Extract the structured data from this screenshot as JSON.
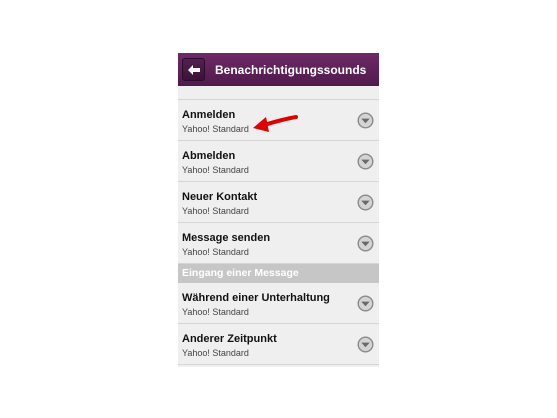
{
  "header": {
    "title": "Benachrichtigungssounds"
  },
  "items_top": [
    {
      "label": "Anmelden",
      "value": "Yahoo! Standard"
    },
    {
      "label": "Abmelden",
      "value": "Yahoo! Standard"
    },
    {
      "label": "Neuer Kontakt",
      "value": "Yahoo! Standard"
    },
    {
      "label": "Message senden",
      "value": "Yahoo! Standard"
    }
  ],
  "section": {
    "title": "Eingang einer Message"
  },
  "items_bottom": [
    {
      "label": "Während einer Unterhaltung",
      "value": "Yahoo! Standard"
    },
    {
      "label": "Anderer Zeitpunkt",
      "value": "Yahoo! Standard"
    }
  ],
  "colors": {
    "header": "#5e2058",
    "annotation_arrow": "#e00000",
    "section_bg": "#c6c6c6"
  },
  "icons": {
    "back": "back-arrow-icon",
    "dropdown": "dropdown-chevron-icon"
  }
}
